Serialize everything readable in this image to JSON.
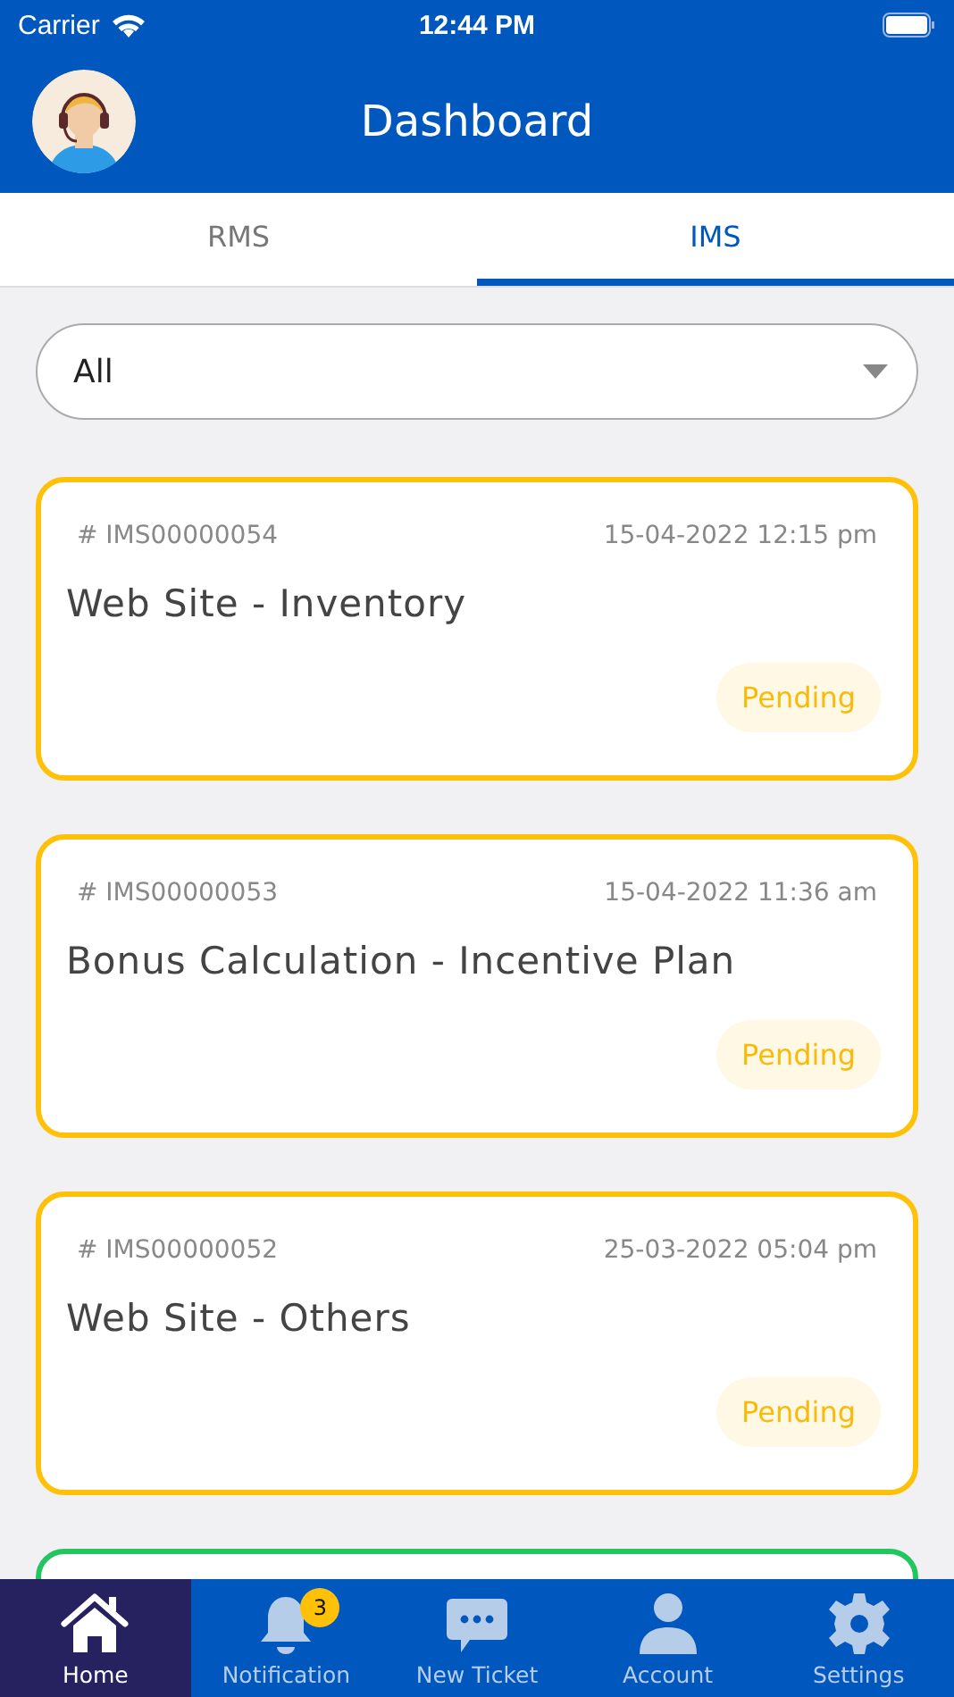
{
  "status_bar": {
    "carrier": "Carrier",
    "time": "12:44 PM"
  },
  "header": {
    "title": "Dashboard"
  },
  "tabs": [
    {
      "label": "RMS",
      "selected": false
    },
    {
      "label": "IMS",
      "selected": true
    }
  ],
  "filter": {
    "value": "All"
  },
  "tickets": [
    {
      "id": "# IMS00000054",
      "date": "15-04-2022 12:15 pm",
      "title": "Web Site - Inventory",
      "status": "Pending",
      "color": "#ffc107"
    },
    {
      "id": "# IMS00000053",
      "date": "15-04-2022 11:36 am",
      "title": "Bonus Calculation - Incentive Plan",
      "status": "Pending",
      "color": "#ffc107"
    },
    {
      "id": "# IMS00000052",
      "date": "25-03-2022 05:04 pm",
      "title": "Web Site - Others",
      "status": "Pending",
      "color": "#ffc107"
    },
    {
      "color": "#22c55e"
    }
  ],
  "nav": [
    {
      "kind": "home",
      "label": "Home",
      "selected": true
    },
    {
      "kind": "bell",
      "label": "Notification",
      "selected": false,
      "badge": "3"
    },
    {
      "kind": "chat",
      "label": "New Ticket",
      "selected": false
    },
    {
      "kind": "person",
      "label": "Account",
      "selected": false
    },
    {
      "kind": "gear",
      "label": "Settings",
      "selected": false
    }
  ]
}
